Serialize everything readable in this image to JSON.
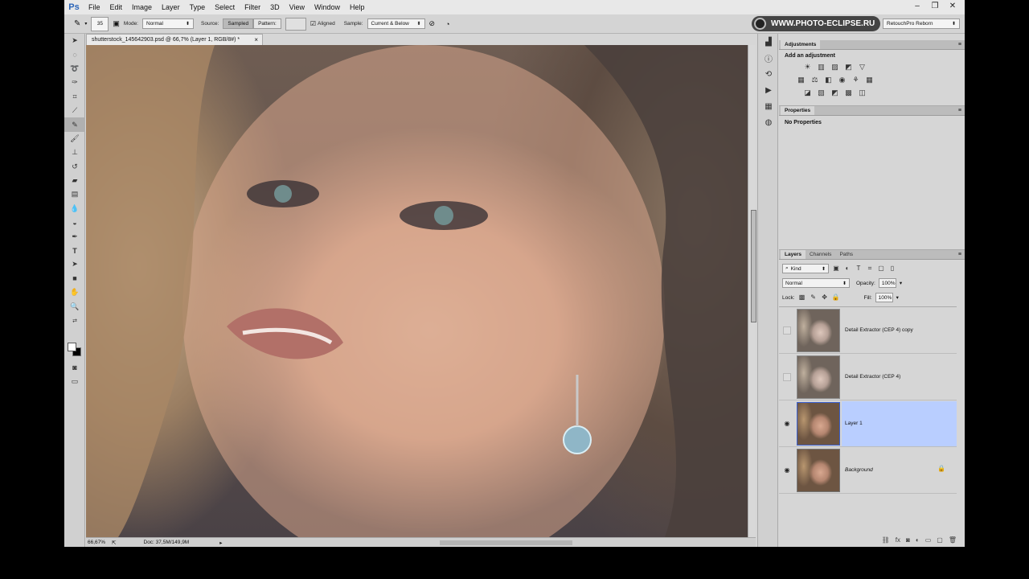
{
  "menubar": {
    "logo": "Ps",
    "items": [
      "File",
      "Edit",
      "Image",
      "Layer",
      "Type",
      "Select",
      "Filter",
      "3D",
      "View",
      "Window",
      "Help"
    ]
  },
  "options": {
    "brush_size": "35",
    "mode_label": "Mode:",
    "mode_value": "Normal",
    "source_label": "Source:",
    "sampled_label": "Sampled",
    "pattern_label": "Pattern:",
    "aligned_label": "Aligned",
    "sample_label": "Sample:",
    "sample_value": "Current & Below",
    "brand": "WWW.PHOTO-ECLIPSE.RU",
    "workspace": "RetouchPro Reborn"
  },
  "document": {
    "tab_title": "shutterstock_145642903.psd @ 66,7% (Layer 1, RGB/8#) *",
    "zoom": "66,67%",
    "doc_info": "Doc: 37,5M/149,9M"
  },
  "panels": {
    "adjustments_tab": "Adjustments",
    "add_adjustment": "Add an adjustment",
    "properties_tab": "Properties",
    "no_properties": "No Properties",
    "layers_tab": "Layers",
    "channels_tab": "Channels",
    "paths_tab": "Paths",
    "kind": "Kind",
    "blend_mode": "Normal",
    "opacity_label": "Opacity:",
    "opacity": "100%",
    "lock_label": "Lock:",
    "fill_label": "Fill:",
    "fill": "100%"
  },
  "layers": [
    {
      "name": "Detail Extractor  (CEP 4) copy",
      "visible": false,
      "selected": false
    },
    {
      "name": "Detail Extractor  (CEP 4)",
      "visible": false,
      "selected": false
    },
    {
      "name": "Layer 1",
      "visible": true,
      "selected": true
    },
    {
      "name": "Background",
      "visible": true,
      "selected": false,
      "locked": true
    }
  ]
}
